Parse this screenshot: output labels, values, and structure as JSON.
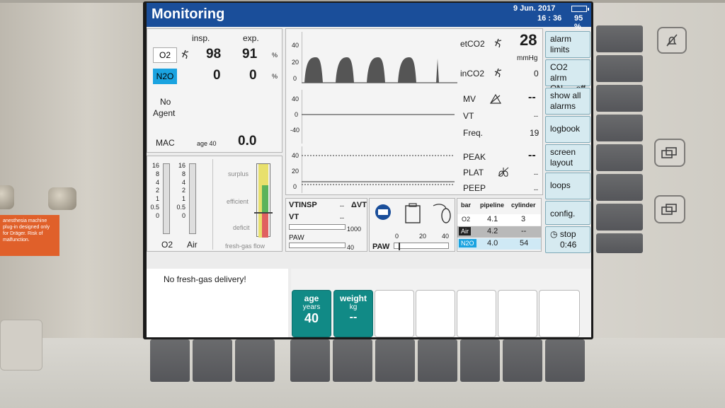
{
  "header": {
    "title": "Monitoring",
    "date": "9 Jun. 2017",
    "time": "16 : 36",
    "battery": "95 %"
  },
  "gases": {
    "col_insp": "insp.",
    "col_exp": "exp.",
    "o2": {
      "label": "O2",
      "insp": "98",
      "exp": "91",
      "unit": "%"
    },
    "n2o": {
      "label": "N2O",
      "insp": "0",
      "exp": "0",
      "unit": "%"
    },
    "agent_line1": "No",
    "agent_line2": "Agent",
    "mac_label": "MAC",
    "mac_age": "age 40",
    "mac_value": "0.0"
  },
  "flow_bars": {
    "o2_label": "O2",
    "air_label": "Air",
    "scale": [
      "16",
      "8",
      "4",
      "2",
      "1",
      "0.5",
      "0"
    ],
    "fresh_gas_label": "fresh-gas flow",
    "surplus": "surplus",
    "efficient": "efficient",
    "deficit": "deficit"
  },
  "waves": {
    "co2_ticks": [
      "40",
      "20",
      "0"
    ],
    "flow_ticks": [
      "40",
      "0",
      "-40"
    ],
    "paw_ticks": [
      "40",
      "20",
      "0"
    ]
  },
  "values": {
    "etco2_label": "etCO2",
    "etco2_value": "28",
    "etco2_unit": "mmHg",
    "inco2_label": "inCO2",
    "inco2_value": "0",
    "mv_label": "MV",
    "mv_value": "--",
    "vt_label": "VT",
    "vt_value": "--",
    "freq_label": "Freq.",
    "freq_value": "19",
    "peak_label": "PEAK",
    "peak_value": "--",
    "plat_label": "PLAT",
    "plat_value": "--",
    "peep_label": "PEEP",
    "peep_value": "--"
  },
  "vt_panel": {
    "vtinsp_label": "VTINSP",
    "vtinsp_value": "--",
    "dvt_label": "ΔVT",
    "dvt_value": "--",
    "vt_label": "VT",
    "vt_scale": "1000",
    "paw_label": "PAW",
    "paw_scale": "40"
  },
  "paw_gauge": {
    "label": "PAW",
    "ticks": [
      "0",
      "20",
      "40"
    ]
  },
  "supply": {
    "headers": [
      "bar",
      "pipeline",
      "cylinder"
    ],
    "rows": [
      {
        "gas": "O2",
        "pipeline": "4.1",
        "cylinder": "3"
      },
      {
        "gas": "Air",
        "pipeline": "4.2",
        "cylinder": "--"
      },
      {
        "gas": "N2O",
        "pipeline": "4.0",
        "cylinder": "54"
      }
    ]
  },
  "softkeys": {
    "alarm_limits_1": "alarm",
    "alarm_limits_2": "limits",
    "co2_alarm_1": "CO2 alrm",
    "co2_alarm_2": "ON → off",
    "show_alarms_1": "show all",
    "show_alarms_2": "alarms",
    "logbook": "logbook",
    "screen_layout_1": "screen",
    "screen_layout_2": "layout",
    "loops": "loops",
    "config": "config.",
    "stop_label": "stop",
    "stop_time": "0:46"
  },
  "message": "No fresh-gas delivery!",
  "bottom_keys": {
    "age_title": "age",
    "age_unit": "years",
    "age_value": "40",
    "weight_title": "weight",
    "weight_unit": "kg",
    "weight_value": "--"
  },
  "housing": {
    "warning_label": "anesthesia machine plug-in designed only for Dräger. Risk of malfunction."
  },
  "colors": {
    "title_bar": "#1a4e9a",
    "n2o_blue": "#1aa3e0",
    "teal": "#118a86",
    "softkey": "#d6eaf0"
  }
}
